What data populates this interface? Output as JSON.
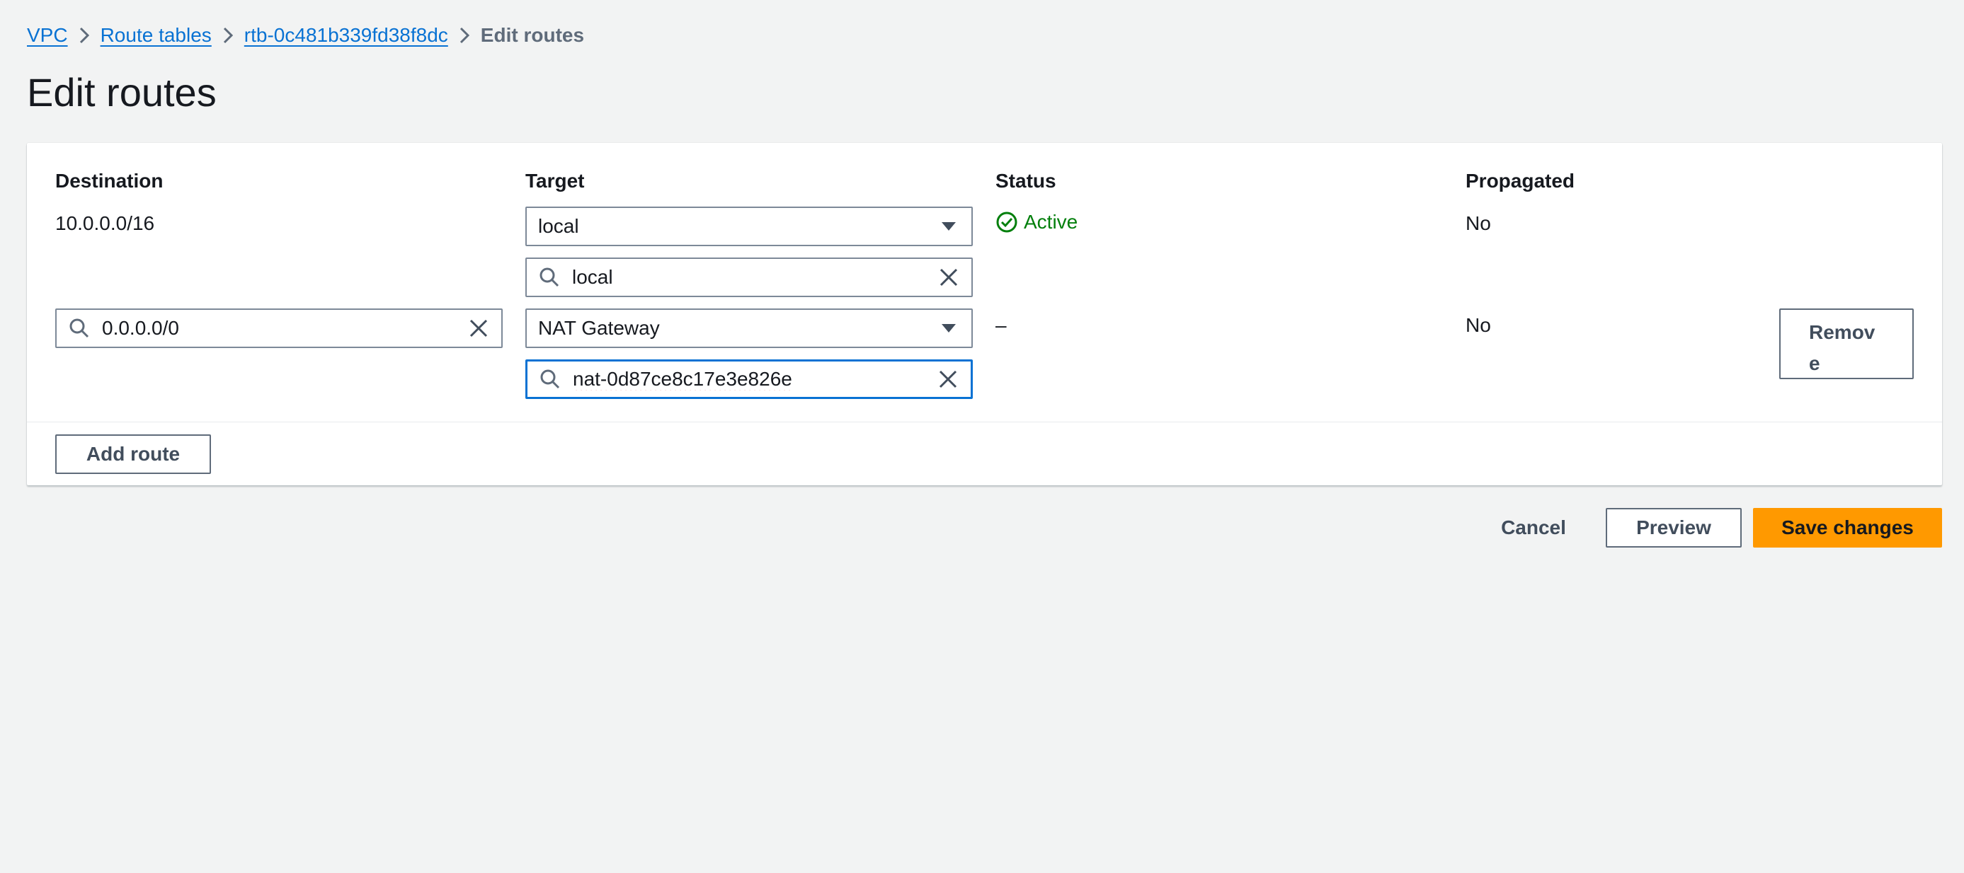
{
  "breadcrumb": {
    "items": [
      "VPC",
      "Route tables",
      "rtb-0c481b339fd38f8dc"
    ],
    "current": "Edit routes"
  },
  "page": {
    "title": "Edit routes"
  },
  "table": {
    "headers": {
      "destination": "Destination",
      "target": "Target",
      "status": "Status",
      "propagated": "Propagated"
    },
    "routes": [
      {
        "destination": "10.0.0.0/16",
        "target_type": "local",
        "target_search": "local",
        "status": "Active",
        "propagated": "No"
      },
      {
        "destination": "0.0.0.0/0",
        "target_type": "NAT Gateway",
        "target_search": "nat-0d87ce8c17e3e826e",
        "status": "–",
        "propagated": "No",
        "remove_label": "Remove"
      }
    ]
  },
  "actions": {
    "add_route": "Add route",
    "cancel": "Cancel",
    "preview": "Preview",
    "save": "Save changes"
  },
  "icons": {
    "breadcrumb_separator": "chevron-right-icon",
    "dropdown": "caret-down-icon",
    "search": "search-icon",
    "clear": "close-icon",
    "status_active": "status-positive-icon"
  },
  "colors": {
    "link": "#0972d3",
    "primary_button": "#ff9900",
    "status_active": "#037f0c",
    "focus_border": "#0972d3",
    "background": "#f2f3f3"
  }
}
